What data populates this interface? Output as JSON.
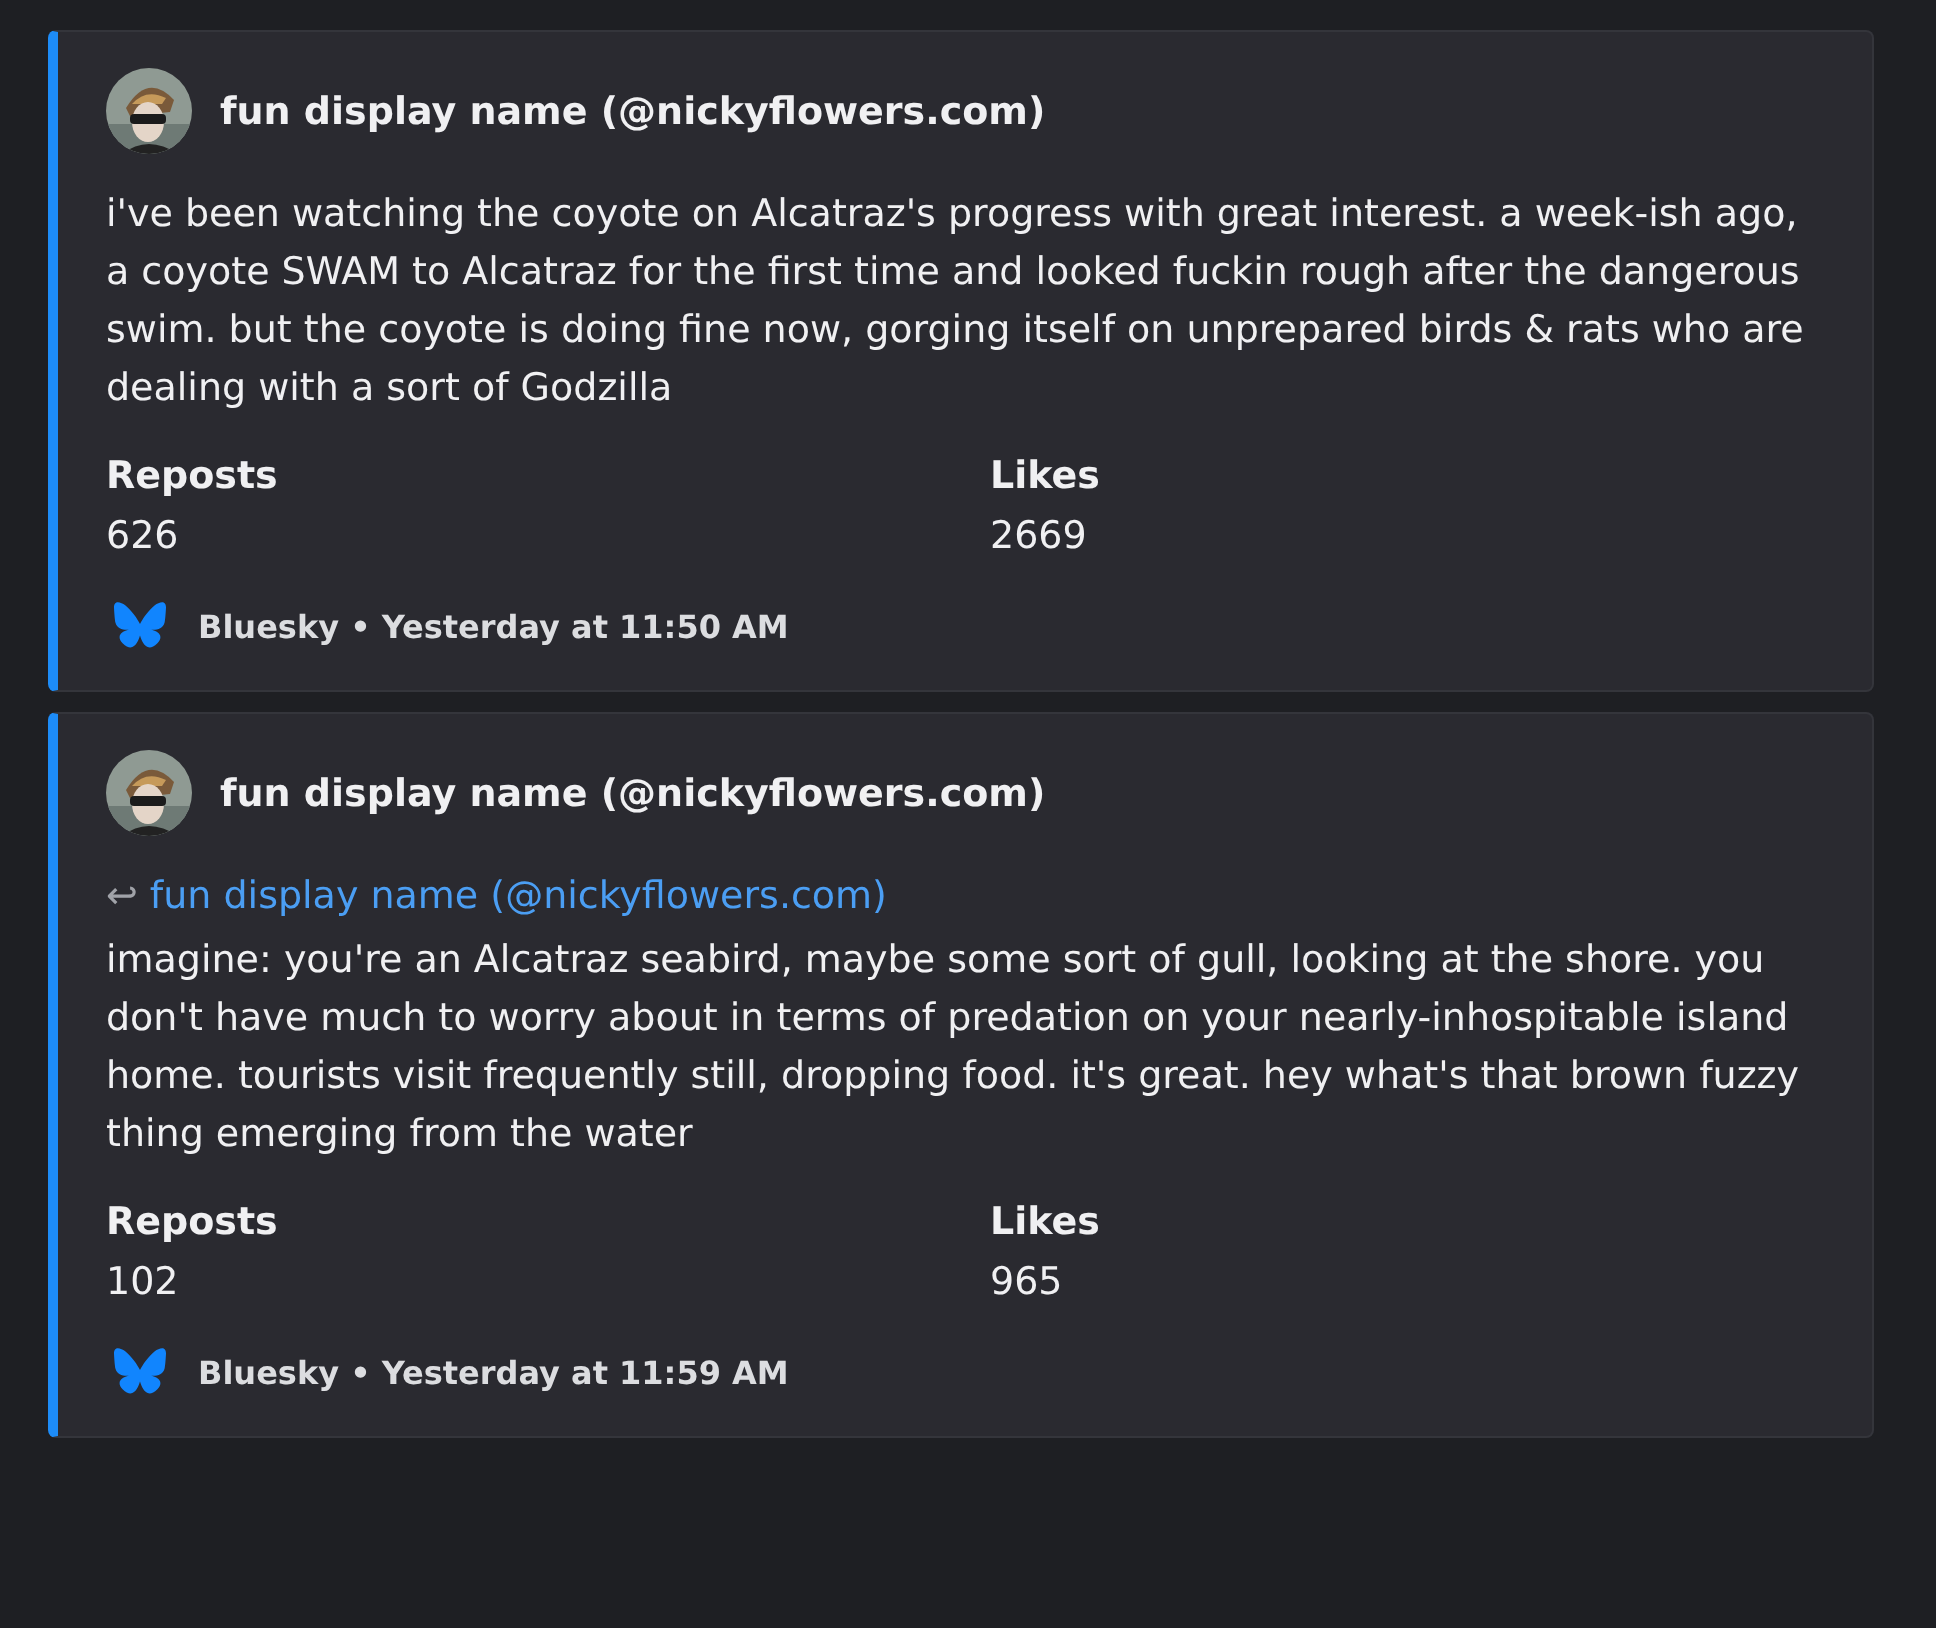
{
  "embeds": [
    {
      "author": "fun display name (@nickyflowers.com)",
      "body": "i've been watching the coyote on Alcatraz's progress with great interest. a week-ish ago, a coyote SWAM to Alcatraz for the first time and looked fuckin rough after the dangerous swim. but the coyote is doing fine now, gorging itself on unprepared birds & rats who are dealing with a sort of Godzilla",
      "fields": [
        {
          "name": "Reposts",
          "value": "626"
        },
        {
          "name": "Likes",
          "value": "2669"
        }
      ],
      "footer": "Bluesky • Yesterday at 11:50 AM"
    },
    {
      "author": "fun display name (@nickyflowers.com)",
      "reply_to": {
        "arrow": "↩",
        "text": "fun display name (@nickyflowers.com)"
      },
      "body": "imagine: you're an Alcatraz seabird, maybe some sort of gull, looking at the shore. you don't have much to worry about in terms of predation on your nearly-inhospitable island home. tourists visit frequently still, dropping food. it's great. hey what's that brown fuzzy thing emerging from the water",
      "fields": [
        {
          "name": "Reposts",
          "value": "102"
        },
        {
          "name": "Likes",
          "value": "965"
        }
      ],
      "footer": "Bluesky • Yesterday at 11:59 AM"
    }
  ]
}
